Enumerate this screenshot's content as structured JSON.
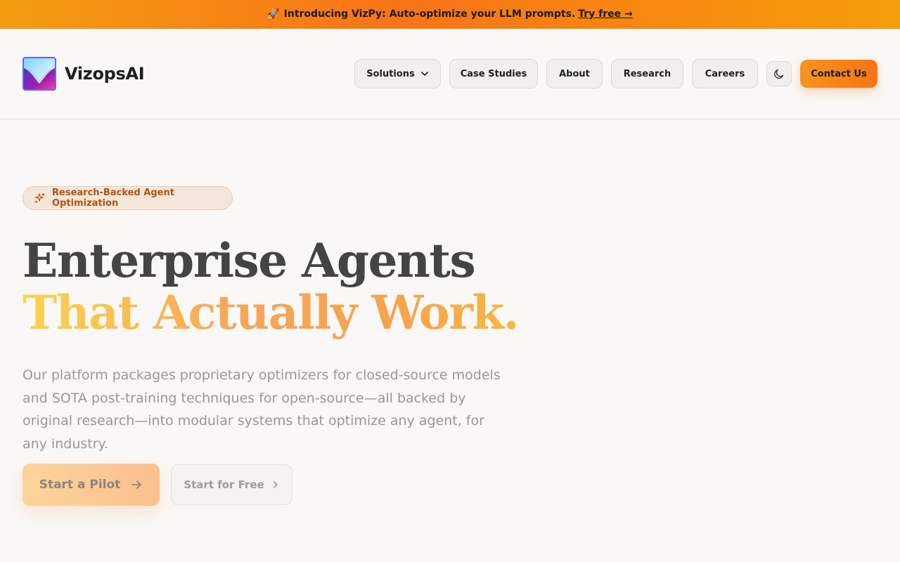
{
  "announcement": {
    "rocket_icon": "🚀",
    "text": "Introducing VizPy: Auto-optimize your LLM prompts.",
    "link_label": "Try free →"
  },
  "header": {
    "brand": "VizopsAI",
    "logo_icon": "vizops-logo-icon",
    "nav": [
      {
        "label": "Solutions",
        "has_dropdown": true
      },
      {
        "label": "Case Studies",
        "has_dropdown": false
      },
      {
        "label": "About",
        "has_dropdown": false
      },
      {
        "label": "Research",
        "has_dropdown": false
      },
      {
        "label": "Careers",
        "has_dropdown": false
      }
    ],
    "theme_toggle_icon": "moon-icon",
    "contact_label": "Contact Us"
  },
  "hero": {
    "badge_icon": "sparkles-icon",
    "badge_label": "Research-Backed Agent Optimization",
    "headline_line1": "Enterprise Agents",
    "headline_line2": "That Actually Work.",
    "description": "Our platform packages proprietary optimizers for closed-source models and SOTA post-training techniques for open-source—all backed by original research—into modular systems that optimize any agent, for any industry.",
    "primary_cta": "Start a Pilot",
    "primary_cta_icon": "arrow-right-icon",
    "secondary_cta": "Start for Free",
    "secondary_cta_icon": "chevron-right-icon"
  },
  "colors": {
    "announcement_gradient_start": "#f39c12",
    "announcement_gradient_mid": "#f97316",
    "accent_orange": "#f97316",
    "badge_text": "#b45309",
    "headline": "#444444",
    "body_text": "#999692",
    "background": "#f9f8f6"
  }
}
